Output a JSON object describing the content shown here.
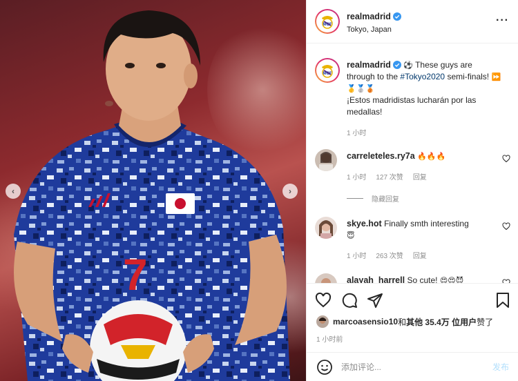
{
  "photo": {
    "prev_arrow": "‹",
    "next_arrow": "›",
    "jersey_number": "7"
  },
  "header": {
    "username": "realmadrid",
    "location": "Tokyo, Japan",
    "more_icon": "more-horizontal-icon"
  },
  "caption": {
    "username": "realmadrid",
    "lead_emoji": "⚽",
    "text_before": " These guys are through to the ",
    "hashtag": "#Tokyo2020",
    "text_after": " semi-finals! ",
    "arrow_emoji": "⏩",
    "medals": "🥇🥈🥉",
    "spanish": "¡Estos madridistas lucharán por las medallas!",
    "time": "1 小时"
  },
  "comments": [
    {
      "username": "carreleteles.ry7a",
      "text": "🔥🔥🔥",
      "time": "1 小时",
      "likes": "127 次赞",
      "reply": "回复"
    },
    {
      "username": "skye.hot",
      "text": "Finally smth interesting",
      "emoji": "😇",
      "time": "1 小时",
      "likes": "263 次赞",
      "reply": "回复"
    },
    {
      "username": "alayah_harrell",
      "text": "So cute!",
      "emoji": "😍😍😈"
    }
  ],
  "hide_replies": "隐藏回复",
  "actions": {
    "likes_user": "marcoasensio10",
    "likes_and": " 和 ",
    "likes_others": "其他 35.4万 位用户",
    "likes_suffix": " 赞了",
    "posted": "1 小时前"
  },
  "add_comment": {
    "placeholder": "添加评论...",
    "post_label": "发布"
  },
  "colors": {
    "jersey": "#1f3b9c",
    "link": "#00376b",
    "verified": "#3897f0",
    "post_disabled": "#b2dffc"
  }
}
